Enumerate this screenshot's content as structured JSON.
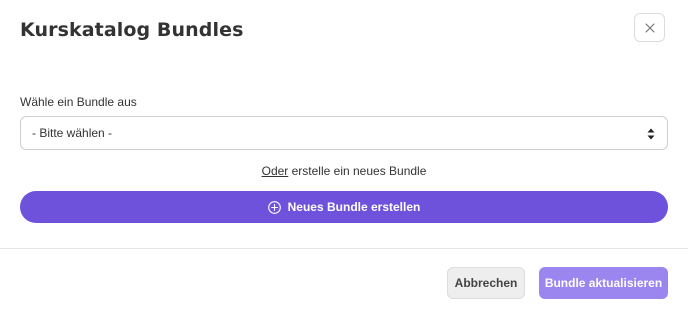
{
  "modal": {
    "title": "Kurskatalog Bundles",
    "close_icon": "close-icon"
  },
  "form": {
    "label": "Wähle ein Bundle aus",
    "select_value": "- Bitte wählen -",
    "select_icon": "updown-arrows-icon",
    "or_link": "Oder",
    "or_text": " erstelle ein neues Bundle",
    "new_bundle_label": "Neues Bundle erstellen",
    "new_bundle_icon": "plus-circle-icon"
  },
  "footer": {
    "cancel_label": "Abbrechen",
    "update_label": "Bundle aktualisieren"
  },
  "colors": {
    "primary": "#6f52dc",
    "primary_disabled": "#9a86ee"
  }
}
